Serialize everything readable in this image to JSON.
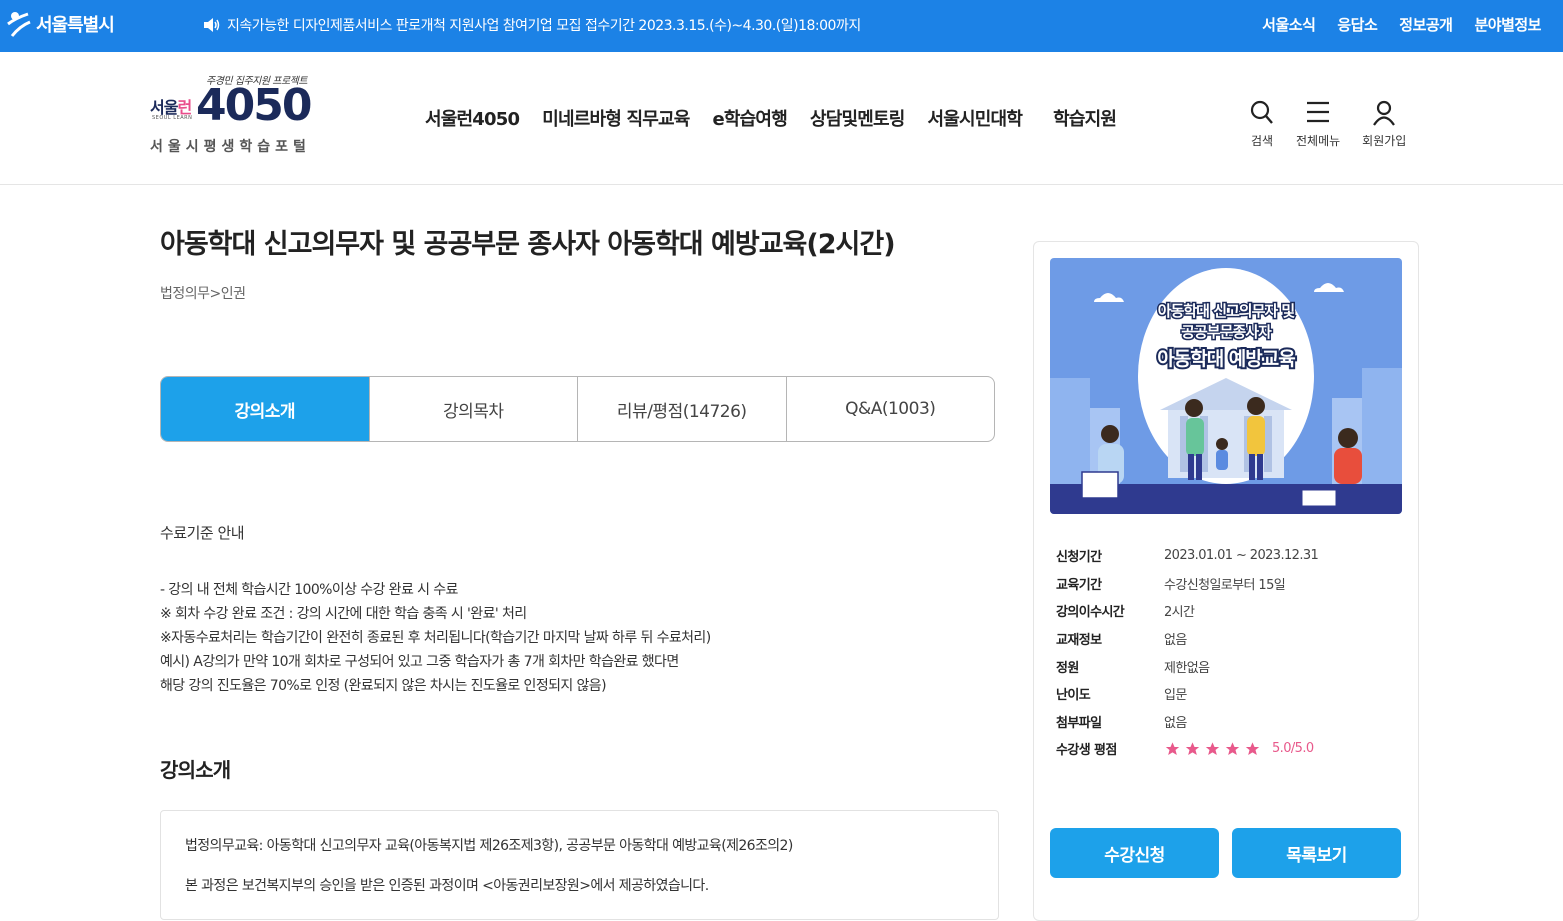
{
  "topbar": {
    "city_logo": "서울특별시",
    "notice": "지속가능한 디자인제품서비스 판로개척 지원사업 참여기업 모집 접수기간 2023.3.15.(수)~4.30.(일)18:00까지",
    "links": [
      "서울소식",
      "응답소",
      "정보공개",
      "분야별정보"
    ]
  },
  "brand": {
    "slogan": "주경민 집주지원 프로젝트",
    "seoul_run_a": "서울",
    "seoul_run_b": "런",
    "sub_en": "SEOUL LEARN",
    "number": "4050",
    "portal": "서울시평생학습포털"
  },
  "gnb": [
    "서울런4050",
    "미네르바형 직무교육",
    "e학습여행",
    "상담및멘토링",
    "서울시민대학",
    "학습지원"
  ],
  "header_icons": {
    "search": "검색",
    "menu": "전체메뉴",
    "signup": "회원가입"
  },
  "course": {
    "title": "아동학대 신고의무자 및 공공부문 종사자 아동학대 예방교육(2시간)",
    "breadcrumb": "법정의무>인권"
  },
  "tabs": [
    "강의소개",
    "강의목차",
    "리뷰/평점(14726)",
    "Q&A(1003)"
  ],
  "criteria": {
    "title": "수료기준 안내",
    "lines": [
      "- 강의 내 전체 학습시간 100%이상 수강 완료 시 수료",
      "※ 회차 수강 완료 조건 : 강의 시간에 대한 학습 충족 시 '완료' 처리",
      "※자동수료처리는 학습기간이 완전히 종료된 후 처리됩니다(학습기간 마지막 날짜 하루 뒤 수료처리)",
      "예시) A강의가 만약 10개 회차로 구성되어 있고 그중 학습자가 총 7개 회차만 학습완료 했다면",
      "해당 강의 진도율은 70%로 인정 (완료되지 않은 차시는 진도율로 인정되지 않음)"
    ]
  },
  "intro": {
    "title": "강의소개",
    "lines": [
      "법정의무교육:  아동학대 신고의무자 교육(아동복지법 제26조제3항),  공공부문 아동학대 예방교육(제26조의2)",
      "본 과정은 보건복지부의 승인을 받은 인증된 과정이며 <아동권리보장원>에서 제공하였습니다."
    ]
  },
  "thumbnail": {
    "line1": "아동학대 신고의무자 및",
    "line2": "공공부문종사자",
    "line3": "아동학대 예방교육"
  },
  "info": [
    {
      "k": "신청기간",
      "v": "2023.01.01 ~ 2023.12.31"
    },
    {
      "k": "교육기간",
      "v": "수강신청일로부터 15일"
    },
    {
      "k": "강의이수시간",
      "v": "2시간"
    },
    {
      "k": "교재정보",
      "v": "없음"
    },
    {
      "k": "정원",
      "v": "제한없음"
    },
    {
      "k": "난이도",
      "v": "입문"
    },
    {
      "k": "첨부파일",
      "v": "없음"
    }
  ],
  "rating": {
    "label": "수강생 평점",
    "score": "5.0/5.0",
    "stars": 5
  },
  "buttons": {
    "apply": "수강신청",
    "list": "목록보기"
  },
  "colors": {
    "topbar": "#1c82e6",
    "accent": "#1da1ea",
    "star": "#e8598b",
    "navy": "#1b2a5a"
  }
}
